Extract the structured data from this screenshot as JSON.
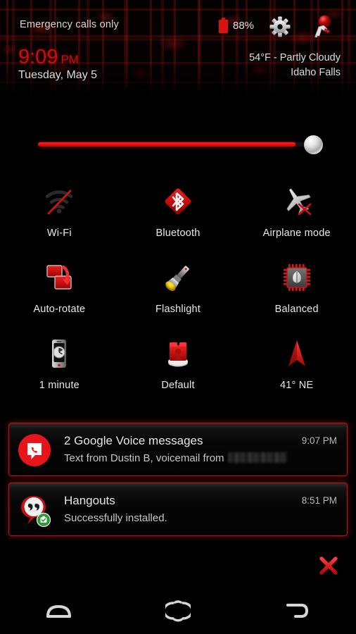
{
  "statusbar": {
    "carrier": "Emergency calls only",
    "battery_percent": "88%",
    "battery_icon": "battery-full-icon",
    "settings_icon": "gear-icon",
    "user_icon": "user-avatar-icon",
    "accent_color": "#cc0d0d"
  },
  "header": {
    "time": "9:09",
    "ampm": "PM",
    "date": "Tuesday, May 5",
    "weather_condition": "54°F - Partly Cloudy",
    "weather_location": "Idaho Falls"
  },
  "brightness": {
    "label": "brightness-slider",
    "value_percent": 92
  },
  "tiles": [
    [
      {
        "label": "Wi-Fi",
        "icon": "wifi-off-icon",
        "state": "off"
      },
      {
        "label": "Bluetooth",
        "icon": "bluetooth-icon",
        "state": "on"
      },
      {
        "label": "Airplane mode",
        "icon": "airplane-off-icon",
        "state": "off"
      }
    ],
    [
      {
        "label": "Auto-rotate",
        "icon": "auto-rotate-icon",
        "state": "on"
      },
      {
        "label": "Flashlight",
        "icon": "flashlight-icon",
        "state": "off"
      },
      {
        "label": "Balanced",
        "icon": "cpu-performance-icon",
        "state": "on"
      }
    ],
    [
      {
        "label": "1 minute",
        "icon": "screen-timeout-icon",
        "state": "on"
      },
      {
        "label": "Default",
        "icon": "sound-profile-icon",
        "state": "on"
      },
      {
        "label": "41° NE",
        "icon": "compass-icon",
        "state": "on"
      }
    ]
  ],
  "notifications": [
    {
      "app_icon": "google-voice-icon",
      "title": "2 Google Voice messages",
      "body": "Text from Dustin B, voicemail from",
      "body_redacted": true,
      "time": "9:07 PM"
    },
    {
      "app_icon": "hangouts-icon",
      "badge_icon": "play-store-badge-icon",
      "title": "Hangouts",
      "body": "Successfully installed.",
      "body_redacted": false,
      "time": "8:51 PM"
    }
  ],
  "clear_all": {
    "icon": "clear-all-x-icon"
  },
  "navbar": [
    {
      "icon": "recents-icon"
    },
    {
      "icon": "home-icon"
    },
    {
      "icon": "back-icon"
    }
  ]
}
